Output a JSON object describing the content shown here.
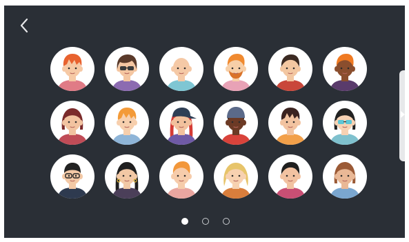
{
  "navigation": {
    "back_icon": "chevron-left-icon"
  },
  "avatar_grid": {
    "rows": 3,
    "columns": 6,
    "avatars": [
      {
        "skin": "#f6c9a5",
        "hair": "#e8622f",
        "hair_style": "spiky",
        "accessory": "none",
        "shirt": "#e07b86",
        "accent": "#e8622f"
      },
      {
        "skin": "#f4c6a1",
        "hair": "#5a3a2a",
        "hair_style": "wavy",
        "accessory": "sunglasses",
        "shirt": "#8c6bb1",
        "accent": "#3b3b3b"
      },
      {
        "skin": "#f5c9a6",
        "hair": "#e0b48e",
        "hair_style": "bald",
        "accessory": "none",
        "shirt": "#7fc6d3",
        "accent": "#f5c9a6"
      },
      {
        "skin": "#f7cfa8",
        "hair": "#f08a30",
        "hair_style": "quiff",
        "accessory": "beard",
        "shirt": "#e8a2b6",
        "accent": "#d9732a"
      },
      {
        "skin": "#f3c7a1",
        "hair": "#3b2a22",
        "hair_style": "side",
        "accessory": "none",
        "shirt": "#c9473a",
        "accent": "#3b2a22"
      },
      {
        "skin": "#8a4e2e",
        "hair": "#f07a22",
        "hair_style": "quiff",
        "accessory": "none",
        "shirt": "#5a3b6b",
        "accent": "#f07a22"
      },
      {
        "skin": "#f2c3a0",
        "hair": "#7b2b2b",
        "hair_style": "bob",
        "accessory": "none",
        "shirt": "#c04c57",
        "accent": "#7b2b2b"
      },
      {
        "skin": "#f7cfad",
        "hair": "#f39a38",
        "hair_style": "spiky",
        "accessory": "none",
        "shirt": "#8fb5d8",
        "accent": "#f39a38"
      },
      {
        "skin": "#f2c19d",
        "hair": "#d53b35",
        "hair_style": "long",
        "accessory": "cap",
        "shirt": "#6f5aa6",
        "accent": "#2f3f55"
      },
      {
        "skin": "#6c3a25",
        "hair": "#2a1f1b",
        "hair_style": "short",
        "accessory": "beanie",
        "shirt": "#d9433b",
        "accent": "#5b6a89"
      },
      {
        "skin": "#f2c3a0",
        "hair": "#3b2320",
        "hair_style": "spiky",
        "accessory": "none",
        "shirt": "#f2a04a",
        "accent": "#3b2320"
      },
      {
        "skin": "#f7d2b3",
        "hair": "#222222",
        "hair_style": "bob",
        "accessory": "sunglasses",
        "shirt": "#7fc1ce",
        "accent": "#5cc6d6"
      },
      {
        "skin": "#f3c9a6",
        "hair": "#222222",
        "hair_style": "short",
        "accessory": "glasses",
        "shirt": "#2e3a4f",
        "accent": "#222222"
      },
      {
        "skin": "#f2c8a5",
        "hair": "#1f1f1f",
        "hair_style": "long",
        "accessory": "earrings",
        "shirt": "#4b3f59",
        "accent": "#e0b43a"
      },
      {
        "skin": "#f6ccab",
        "hair": "#f2973a",
        "hair_style": "quiff",
        "accessory": "none",
        "shirt": "#e9a6a0",
        "accent": "#f2973a"
      },
      {
        "skin": "#f7d1b0",
        "hair": "#e7c46a",
        "hair_style": "curly",
        "accessory": "none",
        "shirt": "#d97e3c",
        "accent": "#e7c46a"
      },
      {
        "skin": "#f2c2a1",
        "hair": "#1f1f1f",
        "hair_style": "side",
        "accessory": "none",
        "shirt": "#c94f74",
        "accent": "#1f1f1f"
      },
      {
        "skin": "#e9b896",
        "hair": "#9b5a36",
        "hair_style": "bob",
        "accessory": "none",
        "shirt": "#7aa6cf",
        "accent": "#9b5a36"
      }
    ]
  },
  "pager": {
    "page_count": 3,
    "current_page": 1
  },
  "side_panel": {
    "handle_icon": "triangle-right-icon"
  },
  "colors": {
    "background": "#2a2f36",
    "avatar_circle": "#ffffff",
    "dot_active": "#ffffff",
    "dot_inactive": "#c8cbcf"
  }
}
